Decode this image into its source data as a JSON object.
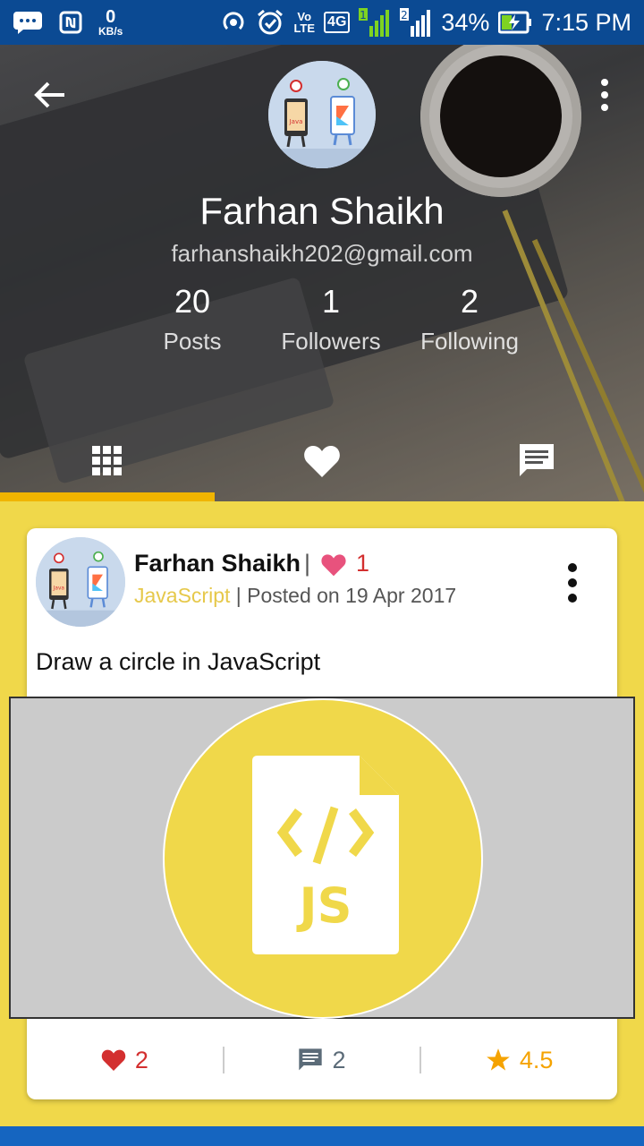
{
  "status_bar": {
    "net_speed_value": "0",
    "net_speed_unit": "KB/s",
    "volte_tag": "Vo",
    "lte_tag": "LTE",
    "network": "4G",
    "sim1": "1",
    "sim2": "2",
    "battery": "34%",
    "time": "7:15 PM"
  },
  "profile": {
    "name": "Farhan Shaikh",
    "email": "farhanshaikh202@gmail.com",
    "stats": [
      {
        "value": "20",
        "label": "Posts"
      },
      {
        "value": "1",
        "label": "Followers"
      },
      {
        "value": "2",
        "label": "Following"
      }
    ]
  },
  "tabs": [
    {
      "icon": "grid-icon",
      "active": true
    },
    {
      "icon": "heart-icon",
      "active": false
    },
    {
      "icon": "comment-icon",
      "active": false
    }
  ],
  "post": {
    "author": "Farhan Shaikh",
    "separator": "|",
    "likes": "1",
    "language": "JavaScript",
    "posted": " | Posted on 19 Apr 2017",
    "title": "Draw a circle in JavaScript",
    "image_label": "JS",
    "actions": {
      "likes": "2",
      "comments": "2",
      "rating": "4.5"
    }
  },
  "colors": {
    "status_bar": "#0b4a93",
    "accent_yellow": "#f0d84a",
    "tab_indicator": "#f0b400",
    "like_red": "#d32f2f",
    "rating_orange": "#f5a300"
  }
}
